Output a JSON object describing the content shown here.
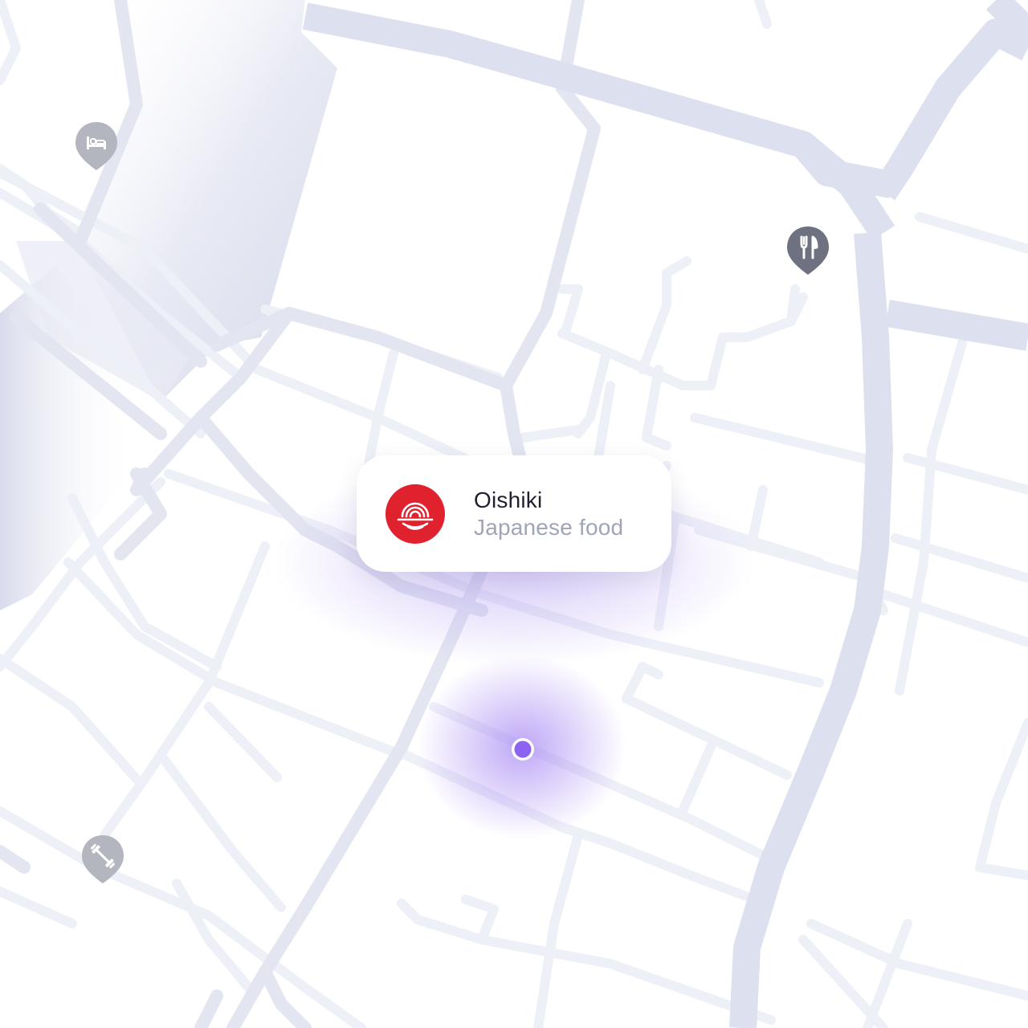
{
  "map": {
    "place_card": {
      "name": "Oishiki",
      "category": "Japanese food",
      "logo_color": "#e0212e"
    },
    "markers": [
      {
        "icon": "bed-icon",
        "category": "hotel",
        "color": "#b4b6bf"
      },
      {
        "icon": "fork-knife-icon",
        "category": "restaurant",
        "color": "#6e7280"
      },
      {
        "icon": "dumbbell-icon",
        "category": "gym",
        "color": "#b4b6bf"
      }
    ],
    "user_location": {
      "color": "#8b63f0"
    },
    "colors": {
      "road_main": "#dde0ee",
      "road_minor": "#eef0f8",
      "accent_glow": "#b8a4f5"
    }
  }
}
